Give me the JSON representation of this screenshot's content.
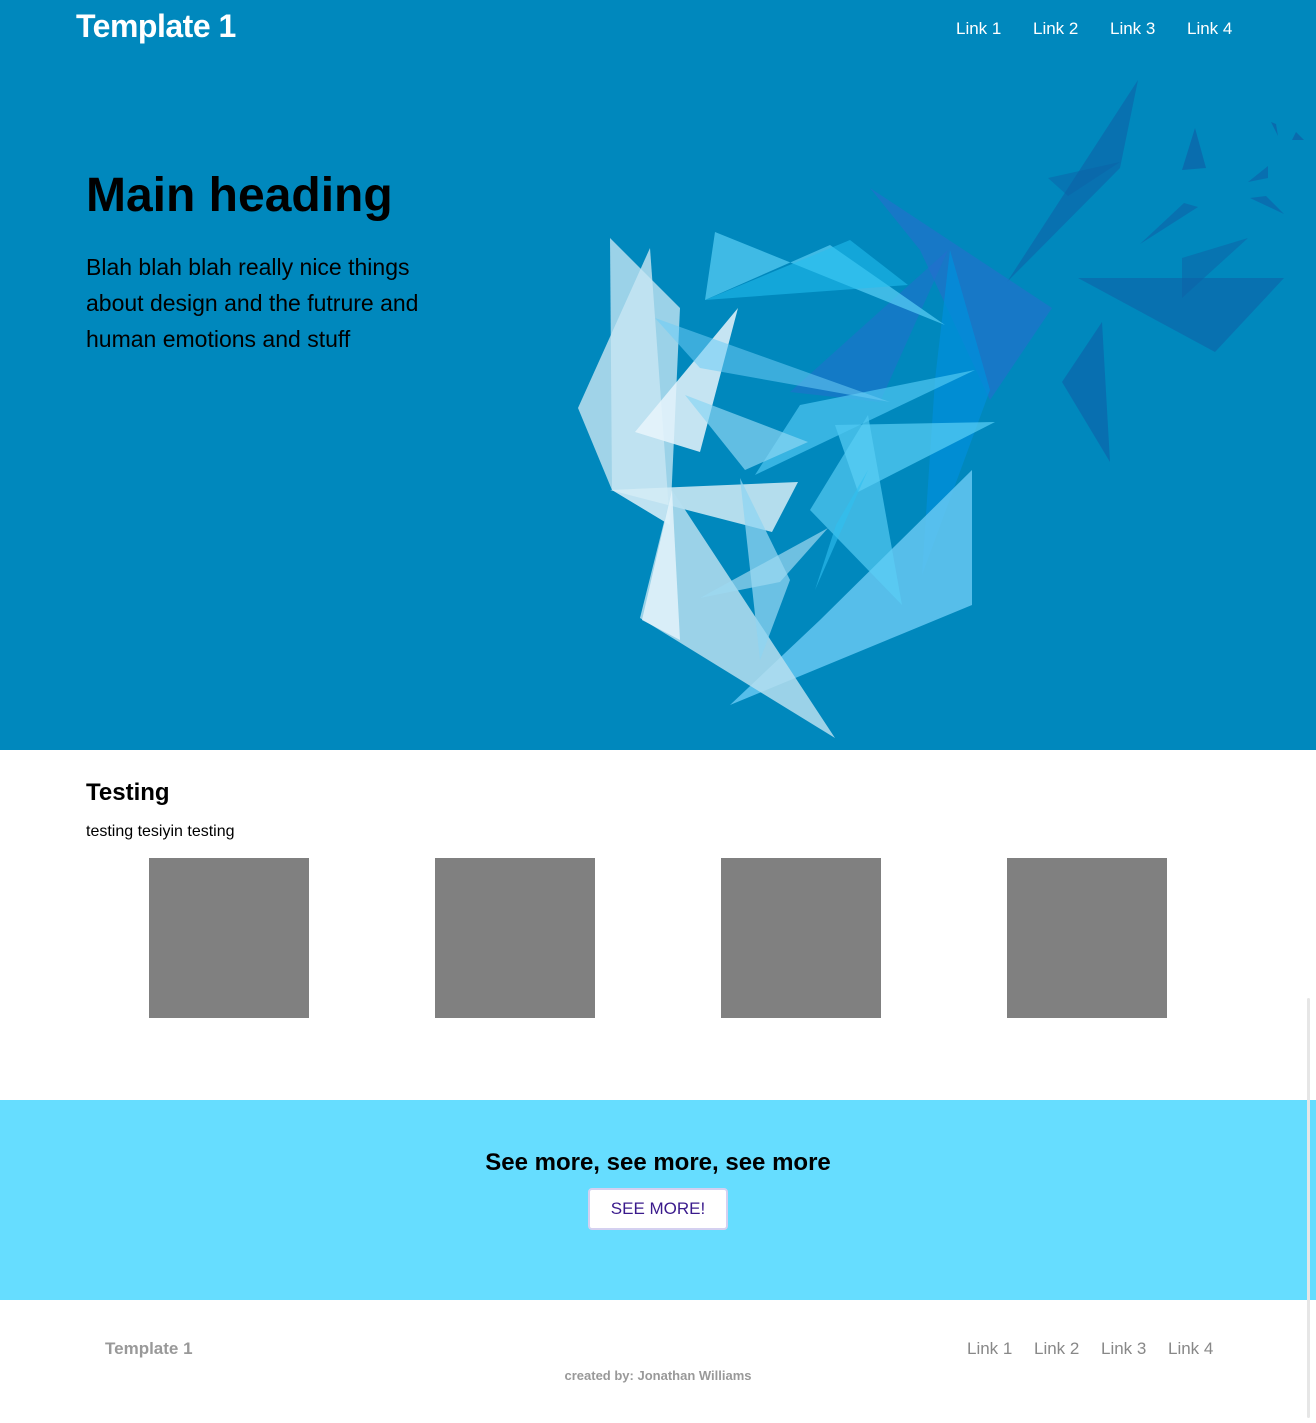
{
  "header": {
    "brand": "Template 1",
    "nav": [
      "Link 1",
      "Link 2",
      "Link 3",
      "Link 4"
    ]
  },
  "hero": {
    "heading": "Main heading",
    "text": "Blah blah blah really nice things about design and the futrure and human emotions and stuff"
  },
  "section": {
    "title": "Testing",
    "text": "testing tesiyin testing"
  },
  "cta": {
    "title": "See more, see more, see more",
    "button": "SEE MORE!"
  },
  "footer": {
    "brand": "Template 1",
    "links": [
      "Link 1",
      "Link 2",
      "Link 3",
      "Link 4"
    ],
    "credit": "created by: Jonathan Williams"
  },
  "colors": {
    "hero_bg": "#0088bd",
    "cta_bg": "#66ddff",
    "placeholder": "#808080"
  }
}
